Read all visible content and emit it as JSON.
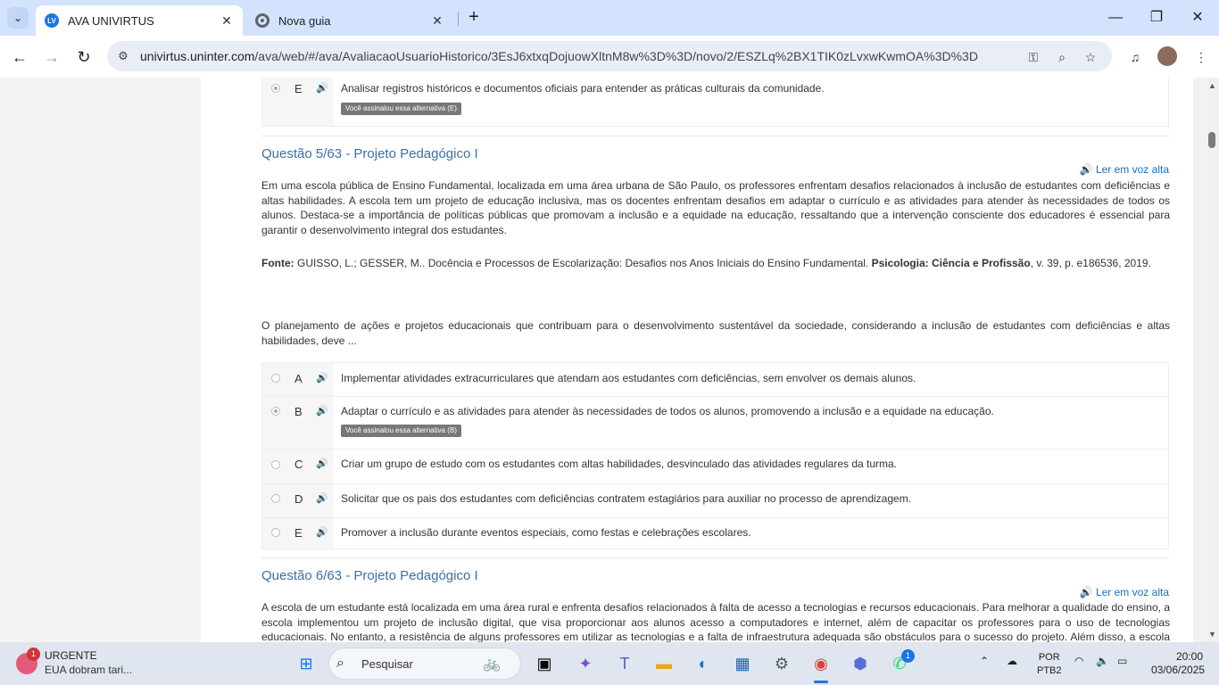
{
  "browser": {
    "tabs": [
      {
        "title": "AVA UNIVIRTUS",
        "favicon": "LV"
      },
      {
        "title": "Nova guia"
      }
    ],
    "url_host": "univirtus.uninter.com",
    "url_path": "/ava/web/#/ava/AvaliacaoUsuarioHistorico/3EsJ6xtxqDojuowXltnM8w%3D%3D/novo/2/ESZLq%2BX1TIK0zLvxwKwmOA%3D%3D"
  },
  "prev_question": {
    "option_e": {
      "letter": "E",
      "text": "Analisar registros históricos e documentos oficiais para entender as práticas culturais da comunidade.",
      "badge": "Você assinalou essa alternativa (E)"
    }
  },
  "q5": {
    "title": "Questão 5/63 - Projeto Pedagógico I",
    "read_aloud": "Ler em voz alta",
    "context": "Em uma escola pública de Ensino Fundamental, localizada em uma área urbana de São Paulo, os professores enfrentam desafios relacionados à inclusão de estudantes com deficiências e altas habilidades. A escola tem um projeto de educação inclusiva, mas os docentes enfrentam desafios em adaptar o currículo e as atividades para atender às necessidades de todos os alunos. Destaca-se a importância de políticas públicas que promovam a inclusão e a equidade na educação, ressaltando que a intervenção consciente dos educadores é essencial para garantir o desenvolvimento integral dos estudantes.",
    "source_label": "Fonte:",
    "source_text": " GUISSO, L.; GESSER, M.. Docência e Processos de Escolarização: Desafios nos Anos Iniciais do Ensino Fundamental. ",
    "source_journal": "Psicologia: Ciência e Profissão",
    "source_tail": ", v. 39, p. e186536, 2019.",
    "prompt": "O planejamento de ações e projetos educacionais que contribuam para o desenvolvimento sustentável da sociedade, considerando a inclusão de estudantes com deficiências e altas habilidades, deve ...",
    "options": [
      {
        "letter": "A",
        "text": "Implementar atividades extracurriculares que atendam aos estudantes com deficiências, sem envolver os demais alunos."
      },
      {
        "letter": "B",
        "text": "Adaptar o currículo e as atividades para atender às necessidades de todos os alunos, promovendo a inclusão e a equidade na educação.",
        "badge": "Você assinalou essa alternativa (B)"
      },
      {
        "letter": "C",
        "text": "Criar um grupo de estudo com os estudantes com altas habilidades, desvinculado das atividades regulares da turma."
      },
      {
        "letter": "D",
        "text": "Solicitar que os pais dos estudantes com deficiências contratem estagiários para auxiliar no processo de aprendizagem."
      },
      {
        "letter": "E",
        "text": "Promover a inclusão durante eventos especiais, como festas e celebrações escolares."
      }
    ]
  },
  "q6": {
    "title": "Questão 6/63 - Projeto Pedagógico I",
    "read_aloud": "Ler em voz alta",
    "context": "A escola de um estudante está localizada em uma área rural e enfrenta desafios relacionados à falta de acesso a tecnologias e recursos educacionais. Para melhorar a qualidade do ensino, a escola implementou um projeto de inclusão digital, que visa proporcionar aos alunos acesso a computadores e internet, além de capacitar os professores para o uso de tecnologias educacionais. No entanto, a resistência de alguns professores em utilizar as tecnologias e a falta de infraestrutura adequada são obstáculos para o sucesso do projeto. Além disso, a escola enfrenta dificuldades em"
  },
  "taskbar": {
    "news_title": "URGENTE",
    "news_text": "EUA dobram tari...",
    "news_count": "1",
    "search_placeholder": "Pesquisar",
    "whatsapp_count": "1",
    "lang_line1": "POR",
    "lang_line2": "PTB2",
    "time": "20:00",
    "date": "03/06/2025"
  }
}
